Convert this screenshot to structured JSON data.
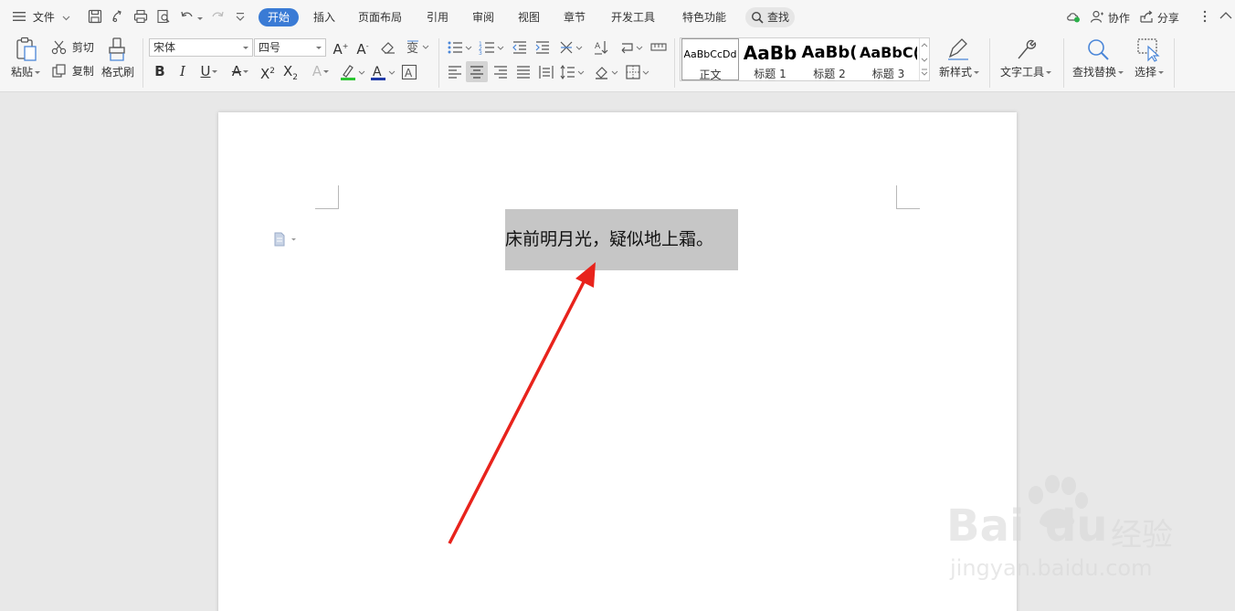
{
  "menubar": {
    "file_label": "文件",
    "tabs": [
      "开始",
      "插入",
      "页面布局",
      "引用",
      "审阅",
      "视图",
      "章节",
      "开发工具",
      "特色功能"
    ],
    "active_tab": "开始",
    "search_label": "查找",
    "collab_label": "协作",
    "share_label": "分享"
  },
  "ribbon": {
    "paste_label": "粘贴",
    "cut_label": "剪切",
    "copy_label": "复制",
    "format_painter_label": "格式刷",
    "font_name": "宋体",
    "font_size": "四号",
    "styles": [
      {
        "sample": "AaBbCcDd",
        "name": "正文"
      },
      {
        "sample": "AaBb",
        "name": "标题 1"
      },
      {
        "sample": "AaBb(",
        "name": "标题 2"
      },
      {
        "sample": "AaBbC(",
        "name": "标题 3"
      }
    ],
    "new_style_label": "新样式",
    "text_tools_label": "文字工具",
    "find_replace_label": "查找替换",
    "select_label": "选择"
  },
  "document": {
    "text": "床前明月光，疑似地上霜。"
  },
  "annotation": {
    "arrow_color": "#e8231c"
  },
  "watermark": {
    "brand": "Bai",
    "brand_tail": "du",
    "product": "经验",
    "url": "jingyan.baidu.com"
  }
}
